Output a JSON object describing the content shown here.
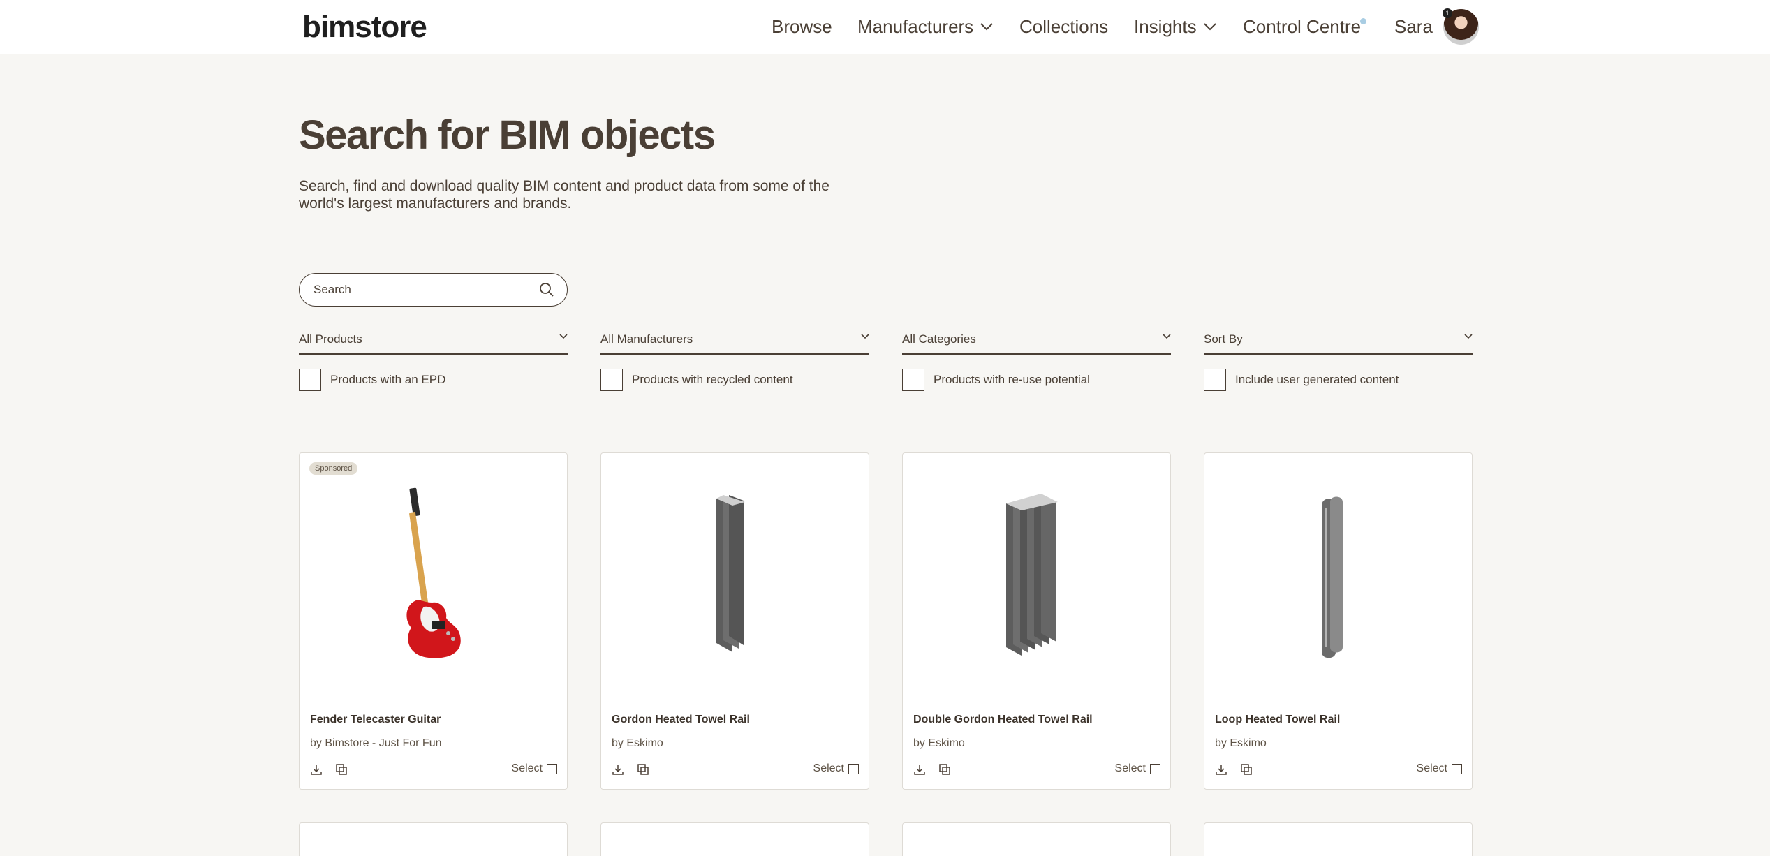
{
  "brand": "bimstore",
  "nav": {
    "browse": "Browse",
    "manufacturers": "Manufacturers",
    "collections": "Collections",
    "insights": "Insights",
    "control_centre": "Control Centre",
    "user": "Sara",
    "avatar_badge": "1"
  },
  "hero": {
    "title": "Search for BIM objects",
    "subtitle": "Search, find and download quality BIM content and product data from some of the world's largest manufacturers and brands."
  },
  "search": {
    "placeholder": "Search"
  },
  "filters": [
    "All Products",
    "All Manufacturers",
    "All Categories",
    "Sort By"
  ],
  "checkboxes": [
    "Products with an EPD",
    "Products with recycled content",
    "Products with re-use potential",
    "Include user generated content"
  ],
  "products": [
    {
      "name": "Fender Telecaster Guitar",
      "by": "by Bimstore - Just For Fun",
      "badge": "Sponsored",
      "select": "Select"
    },
    {
      "name": "Gordon Heated Towel Rail",
      "by": "by Eskimo",
      "select": "Select"
    },
    {
      "name": "Double Gordon Heated Towel Rail",
      "by": "by Eskimo",
      "select": "Select"
    },
    {
      "name": "Loop Heated Towel Rail",
      "by": "by Eskimo",
      "select": "Select"
    }
  ],
  "colors": {
    "text": "#4a3f35",
    "background": "#f7f6f3",
    "accent_dot": "#a9cde3"
  }
}
